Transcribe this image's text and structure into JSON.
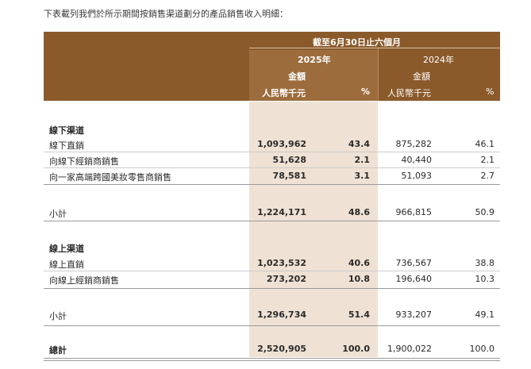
{
  "intro": "下表載列我們於所示期間按銷售渠道劃分的產品銷售收入明細：",
  "header": {
    "period": "截至6月30日止六個月",
    "year_2025": "2025年",
    "year_2024": "2024年",
    "amount_label": "金額",
    "unit_label": "人民幣千元",
    "pct_label": "%"
  },
  "offline": {
    "title": "線下渠道",
    "rows": [
      {
        "label": "線下直銷",
        "a2025": "1,093,962",
        "p2025": "43.4",
        "a2024": "875,282",
        "p2024": "46.1"
      },
      {
        "label": "向線下經銷商銷售",
        "a2025": "51,628",
        "p2025": "2.1",
        "a2024": "40,440",
        "p2024": "2.1"
      },
      {
        "label": "向一家高端跨國美妝零售商銷售",
        "a2025": "78,581",
        "p2025": "3.1",
        "a2024": "51,093",
        "p2024": "2.7"
      }
    ],
    "subtotal": {
      "label": "小計",
      "a2025": "1,224,171",
      "p2025": "48.6",
      "a2024": "966,815",
      "p2024": "50.9"
    }
  },
  "online": {
    "title": "線上渠道",
    "rows": [
      {
        "label": "線上直銷",
        "a2025": "1,023,532",
        "p2025": "40.6",
        "a2024": "736,567",
        "p2024": "38.8"
      },
      {
        "label": "向線上經銷商銷售",
        "a2025": "273,202",
        "p2025": "10.8",
        "a2024": "196,640",
        "p2024": "10.3"
      }
    ],
    "subtotal": {
      "label": "小計",
      "a2025": "1,296,734",
      "p2025": "51.4",
      "a2024": "933,207",
      "p2024": "49.1"
    }
  },
  "total": {
    "label": "總計",
    "a2025": "2,520,905",
    "p2025": "100.0",
    "a2024": "1,900,022",
    "p2024": "100.0"
  }
}
